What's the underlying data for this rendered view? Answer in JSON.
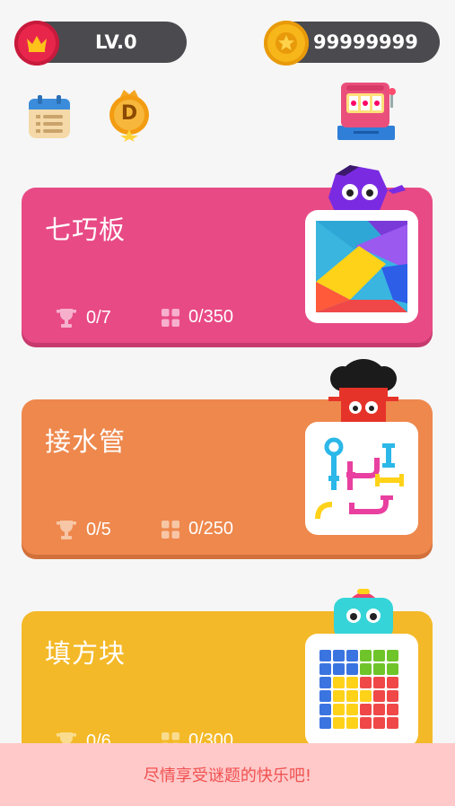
{
  "header": {
    "level_label": "LV.0",
    "coins_label": "99999999"
  },
  "toolbar": {
    "calendar_icon": "calendar-icon",
    "badge_letter": "D",
    "slot_machine_icon": "slot-machine-icon"
  },
  "games": [
    {
      "title": "七巧板",
      "trophies": "0/7",
      "levels": "0/350",
      "color": "#e84a85",
      "shadow": "#c63a6d"
    },
    {
      "title": "接水管",
      "trophies": "0/5",
      "levels": "0/250",
      "color": "#ee884d",
      "shadow": "#d1703a"
    },
    {
      "title": "填方块",
      "trophies": "0/6",
      "levels": "0/300",
      "color": "#f4b928",
      "shadow": "#d49f18"
    }
  ],
  "footer": {
    "message": "尽情享受谜题的快乐吧!"
  },
  "colors": {
    "background": "#f6f6f6",
    "pill": "#4a4a4f",
    "crown_badge": "#e8264b",
    "coin": "#f7b61a"
  }
}
